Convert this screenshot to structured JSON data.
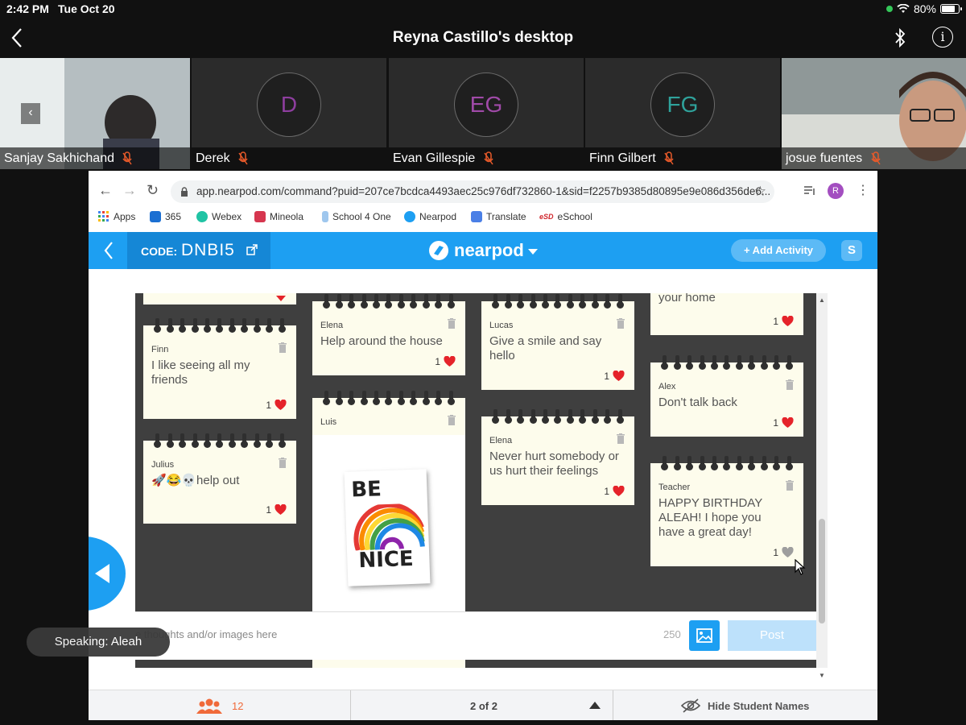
{
  "status_bar": {
    "time": "2:42 PM",
    "date": "Tue Oct 20",
    "battery": "80%",
    "battery_level": 0.8
  },
  "window": {
    "title": "Reyna Castillo's desktop"
  },
  "participants": [
    {
      "name": "Sanjay Sakhichand",
      "initials": ""
    },
    {
      "name": "Derek",
      "initials": "D",
      "color": "#8e3e9f"
    },
    {
      "name": "Evan Gillespie",
      "initials": "EG",
      "color": "#a04aa8"
    },
    {
      "name": "Finn Gilbert",
      "initials": "FG",
      "color": "#2fa29b"
    },
    {
      "name": "josue fuentes",
      "initials": ""
    }
  ],
  "browser": {
    "url": "app.nearpod.com/command?puid=207ce7bcdca4493aec25c976df732860-1&sid=f2257b9385d80895e9e086d356de6...",
    "profile_initial": "R",
    "bookmarks": [
      "Apps",
      "365",
      "Webex",
      "Mineola",
      "School 4 One",
      "Nearpod",
      "Translate",
      "eSchool"
    ],
    "bookmark_marks": [
      "eSD"
    ]
  },
  "nearpod": {
    "code_label": "CODE:",
    "code": "DNBI5",
    "logo": "nearpod",
    "add_activity": "+ Add Activity",
    "s_button": "S"
  },
  "board": {
    "notes": [
      {
        "author": "",
        "text": "",
        "likes": ""
      },
      {
        "author": "Finn",
        "text": "I like seeing all my friends",
        "likes": "1"
      },
      {
        "author": "Julius",
        "text": "🚀😂💀help out",
        "likes": "1"
      },
      {
        "author": "Elena",
        "text": "Help around the house",
        "likes": "1"
      },
      {
        "author": "Luis",
        "text": "",
        "likes": ""
      },
      {
        "author": "Lucas",
        "text": "Give a smile and say hello",
        "likes": "1"
      },
      {
        "author": "Elena",
        "text": "Never hurt somebody or us hurt their feelings",
        "likes": "1"
      },
      {
        "author": "",
        "text": "your home",
        "likes": "1"
      },
      {
        "author": "Alex",
        "text": "Don't talk back",
        "likes": "1"
      },
      {
        "author": "Teacher",
        "text": "HAPPY BIRTHDAY ALEAH! I hope you have a great day!",
        "likes": "1"
      }
    ],
    "image_card": {
      "top": "BE",
      "bottom": "NICE"
    }
  },
  "composer": {
    "placeholder": "e thoughts and/or images here",
    "char_count": "250",
    "post": "Post"
  },
  "footer": {
    "participants_count": "12",
    "pages": "2 of 2",
    "hide_names": "Hide Student Names"
  },
  "speaking": "Speaking: Aleah"
}
